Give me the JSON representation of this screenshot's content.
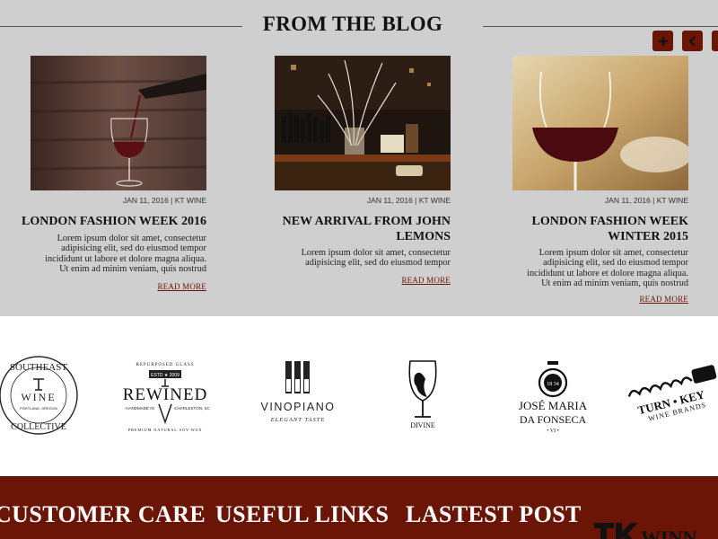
{
  "blog": {
    "title": "FROM THE BLOG",
    "controls": [
      {
        "name": "add",
        "icon": "plus-icon"
      },
      {
        "name": "prev",
        "icon": "chevron-left-icon"
      },
      {
        "name": "next",
        "icon": "chevron-right-icon"
      }
    ],
    "posts": [
      {
        "meta": "JAN 11, 2016 | KT WINE",
        "title": "LONDON FASHION WEEK 2016",
        "excerpt": [
          "Lorem ipsum dolor sit amet, consectetur",
          "adipisicing elit, sed do eiusmod tempor",
          "incididunt ut labore et dolore magna aliqua.",
          "Ut enim ad minim veniam, quis nostrud"
        ],
        "read_more": "READ MORE"
      },
      {
        "meta": "JAN 11, 2016 | KT WINE",
        "title_lines": [
          "NEW ARRIVAL FROM JOHN",
          "LEMONS"
        ],
        "excerpt": [
          "Lorem ipsum dolor sit amet, consectetur",
          "adipisicing elit, sed do eiusmod tempor"
        ],
        "read_more": "READ MORE"
      },
      {
        "meta": "JAN 11, 2016 | KT WINE",
        "title_lines": [
          "LONDON FASHION WEEK",
          "WINTER 2015"
        ],
        "excerpt": [
          "Lorem ipsum dolor sit amet, consectetur",
          "adipisicing elit, sed do eiusmod tempor",
          "incididunt ut labore et dolore magna aliqua.",
          "Ut enim ad minim veniam, quis nostrud"
        ],
        "read_more": "READ MORE"
      }
    ]
  },
  "brands": {
    "southeast": {
      "top": "SOUTHEAST",
      "mid": "WINE",
      "bottom": "COLLECTIVE",
      "sub": "PORTLAND, OREGON"
    },
    "rewined": {
      "arc_top": "REPURPOSED GLASS",
      "badge": "ESTD ★ 2009",
      "name": "REWINED",
      "left": "HANDMADE IN",
      "right": "CHARLESTON, SC",
      "arc_bottom": "PREMIUM NATURAL SOY WAX"
    },
    "vinopiano": {
      "name": "VINOPIANO",
      "tagline": "ELEGANT TASTE"
    },
    "divine": {
      "name": "DIVINE"
    },
    "jose": {
      "seal": "18 34",
      "name1": "JOSÉ MARIA",
      "name2": "DA FONSECA",
      "roman": "• VI •"
    },
    "turnkey": {
      "line1": "TURN • KEY",
      "line2": "WINE BRANDS"
    }
  },
  "footer": {
    "headings": [
      "CUSTOMER CARE",
      "USEFUL LINKS",
      "LASTEST POST"
    ],
    "logo_text": "WINN"
  },
  "colors": {
    "accent": "#6b1507",
    "blog_bg": "#cfcfcf",
    "text": "#111111"
  }
}
